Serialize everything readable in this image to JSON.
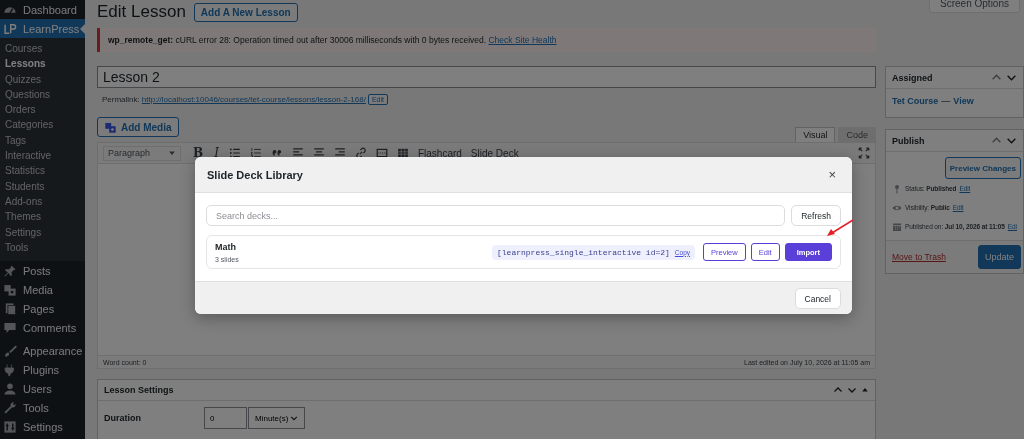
{
  "sidebar": {
    "sections": [
      [
        {
          "label": "Dashboard",
          "selected": false
        },
        {
          "label": "LearnPress",
          "selected": true,
          "children": [
            {
              "label": "Courses",
              "selected": false
            },
            {
              "label": "Lessons",
              "selected": true
            },
            {
              "label": "Quizzes",
              "selected": false
            },
            {
              "label": "Questions",
              "selected": false
            },
            {
              "label": "Orders",
              "selected": false
            },
            {
              "label": "Categories",
              "selected": false
            },
            {
              "label": "Tags",
              "selected": false
            },
            {
              "label": "Interactive",
              "selected": false
            },
            {
              "label": "Statistics",
              "selected": false
            },
            {
              "label": "Students",
              "selected": false
            },
            {
              "label": "Add-ons",
              "selected": false
            },
            {
              "label": "Themes",
              "selected": false
            },
            {
              "label": "Settings",
              "selected": false
            },
            {
              "label": "Tools",
              "selected": false
            }
          ]
        },
        {
          "label": "Posts",
          "selected": false
        },
        {
          "label": "Media",
          "selected": false
        },
        {
          "label": "Pages",
          "selected": false
        },
        {
          "label": "Comments",
          "selected": false
        }
      ],
      [
        {
          "label": "Appearance",
          "selected": false
        },
        {
          "label": "Plugins",
          "selected": false
        },
        {
          "label": "Users",
          "selected": false
        },
        {
          "label": "Tools",
          "selected": false
        },
        {
          "label": "Settings",
          "selected": false
        }
      ]
    ]
  },
  "header": {
    "title": "Edit Lesson",
    "add_button": "Add A New Lesson",
    "screen_options": "Screen Options"
  },
  "notice": {
    "text": "**wp_remote_get:** cURL error 28: Operation timed out after 30006 milliseconds with 0 bytes received.",
    "link": "Check Site Health"
  },
  "title_field": {
    "value": "Lesson 2"
  },
  "permalink": {
    "label": "Permalink:",
    "url": "http://localhost:10046/courses/tet-course/lessons/lesson-2-168/",
    "edit": "Edit"
  },
  "add_media": "Add Media",
  "editor": {
    "tabs": [
      {
        "label": "Visual",
        "selected": true
      },
      {
        "label": "Code",
        "selected": false
      }
    ],
    "format": "Paragraph",
    "bold": "B",
    "italic": "I",
    "extra_buttons": [
      "Flashcard",
      "Slide Deck"
    ],
    "word_count": "Word count: 0",
    "last_edited": "Last edited on July 10, 2026 at 11:05 am"
  },
  "lesson_settings": {
    "title": "Lesson Settings",
    "duration_label": "Duration",
    "duration_value": "0",
    "duration_unit": "Minute(s)"
  },
  "assigned": {
    "title": "Assigned",
    "course": "Tet Course",
    "dash": "—",
    "view": "View"
  },
  "publish": {
    "title": "Publish",
    "preview": "Preview Changes",
    "rows": [
      {
        "text": "Status: **Published**",
        "link": "Edit"
      },
      {
        "text": "Visibility: **Public**",
        "link": "Edit"
      },
      {
        "text": "Published on: **Jul 10, 2026 at 11:05**",
        "link": "Edi"
      }
    ],
    "trash": "Move to Trash",
    "update": "Update"
  },
  "modal": {
    "title": "Slide Deck Library",
    "close": "×",
    "search": {
      "placeholder": "Search decks..."
    },
    "refresh": "Refresh",
    "decks": [
      {
        "name": "Math",
        "count": "3 slides",
        "shortcode": "[learnpress_single_interactive id=2]",
        "copy": "Copy",
        "preview": "Preview",
        "edit": "Edit",
        "import": "Import"
      }
    ],
    "cancel": "Cancel"
  }
}
